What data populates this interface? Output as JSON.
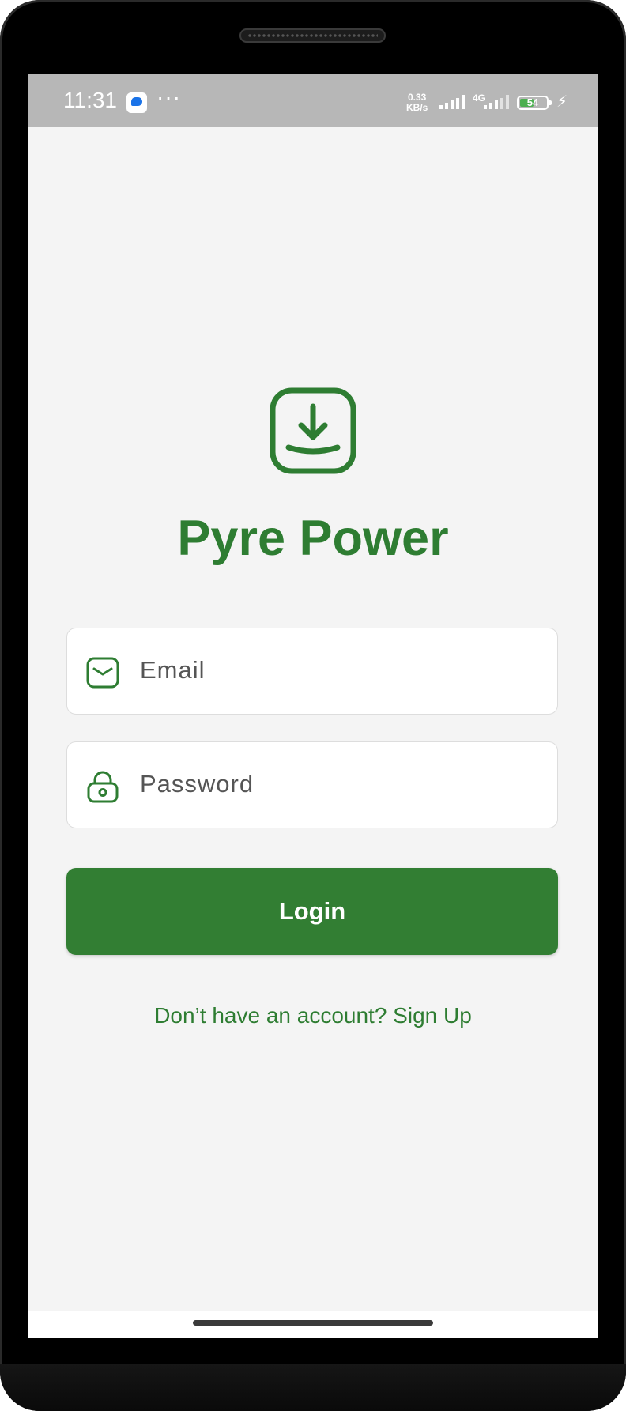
{
  "status_bar": {
    "time": "11:31",
    "more": "···",
    "net_speed_value": "0.33",
    "net_speed_unit": "KB/s",
    "network_type": "4G",
    "battery_level": "54",
    "battery_fraction": 0.54,
    "icons": [
      "messages-app-icon",
      "wifi-signal-icon",
      "cellular-signal-icon",
      "battery-icon",
      "charging-bolt-icon"
    ]
  },
  "app": {
    "title": "Pyre Power",
    "logo_icon": "download-tray-icon"
  },
  "form": {
    "email_placeholder": "Email",
    "email_value": "",
    "email_icon": "mail-icon",
    "password_placeholder": "Password",
    "password_value": "",
    "password_icon": "lock-icon",
    "login_label": "Login",
    "signup_text": "Don’t have an account? Sign Up"
  },
  "colors": {
    "primary": "#2e7d32",
    "button": "#327e33",
    "background": "#f4f4f4",
    "status_bar": "#b7b7b7"
  }
}
